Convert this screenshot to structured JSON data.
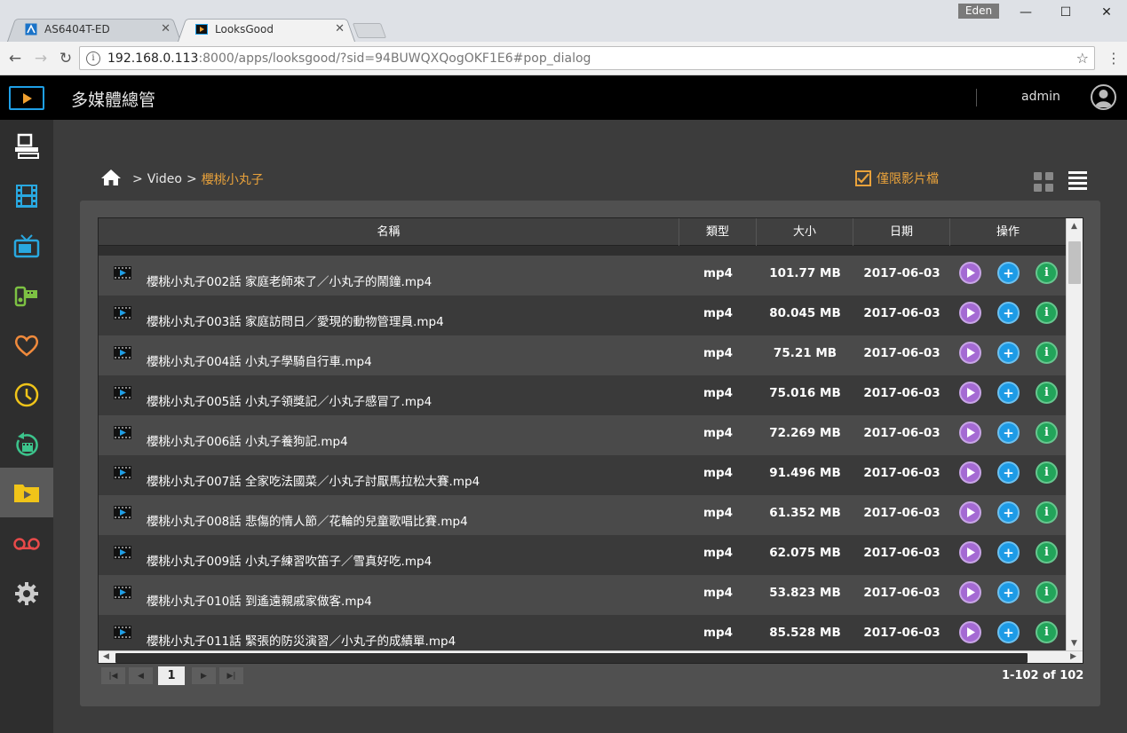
{
  "browser": {
    "tabs": [
      {
        "title": "AS6404T-ED",
        "close": "✕"
      },
      {
        "title": "LooksGood",
        "close": "✕"
      }
    ],
    "profile_name": "Eden",
    "url_host": "192.168.0.113",
    "url_rest": ":8000/apps/looksgood/?sid=94BUWQXQogOKF1E6#pop_dialog",
    "window_controls": {
      "minimize": "—",
      "maximize": "☐",
      "close": "✕"
    }
  },
  "app": {
    "title": "多媒體總管",
    "user": "admin"
  },
  "sidebar": {
    "items": [
      {
        "name": "devices-icon",
        "color": "#ffffff"
      },
      {
        "name": "video-icon",
        "color": "#29a8e0"
      },
      {
        "name": "tv-icon",
        "color": "#29a8e0"
      },
      {
        "name": "camcorder-icon",
        "color": "#7dc243"
      },
      {
        "name": "favorite-icon",
        "color": "#f08a3c"
      },
      {
        "name": "recent-icon",
        "color": "#f0c419"
      },
      {
        "name": "replay-icon",
        "color": "#3cc48c"
      },
      {
        "name": "folder-icon",
        "color": "#f0c419"
      },
      {
        "name": "recording-icon",
        "color": "#e84a4a"
      },
      {
        "name": "settings-icon",
        "color": "#cccccc"
      }
    ],
    "active_index": 7
  },
  "breadcrumb": {
    "sep1": ">",
    "level1": "Video",
    "sep2": ">",
    "current": "櫻桃小丸子"
  },
  "filter": {
    "video_only_label": "僅限影片檔",
    "checked": true
  },
  "table": {
    "columns": [
      "名稱",
      "類型",
      "大小",
      "日期",
      "操作"
    ],
    "rows": [
      {
        "name": "櫻桃小丸子002話 家庭老師來了／小丸子的鬧鐘.mp4",
        "type": "mp4",
        "size": "101.77 MB",
        "date": "2017-06-03"
      },
      {
        "name": "櫻桃小丸子003話 家庭訪問日／愛現的動物管理員.mp4",
        "type": "mp4",
        "size": "80.045 MB",
        "date": "2017-06-03"
      },
      {
        "name": "櫻桃小丸子004話 小丸子學騎自行車.mp4",
        "type": "mp4",
        "size": "75.21 MB",
        "date": "2017-06-03"
      },
      {
        "name": "櫻桃小丸子005話 小丸子領獎記／小丸子感冒了.mp4",
        "type": "mp4",
        "size": "75.016 MB",
        "date": "2017-06-03"
      },
      {
        "name": "櫻桃小丸子006話 小丸子養狗記.mp4",
        "type": "mp4",
        "size": "72.269 MB",
        "date": "2017-06-03"
      },
      {
        "name": "櫻桃小丸子007話 全家吃法國菜／小丸子討厭馬拉松大賽.mp4",
        "type": "mp4",
        "size": "91.496 MB",
        "date": "2017-06-03"
      },
      {
        "name": "櫻桃小丸子008話 悲傷的情人節／花輪的兒童歌唱比賽.mp4",
        "type": "mp4",
        "size": "61.352 MB",
        "date": "2017-06-03"
      },
      {
        "name": "櫻桃小丸子009話 小丸子練習吹笛子／雪真好吃.mp4",
        "type": "mp4",
        "size": "62.075 MB",
        "date": "2017-06-03"
      },
      {
        "name": "櫻桃小丸子010話 到遙遠親戚家做客.mp4",
        "type": "mp4",
        "size": "53.823 MB",
        "date": "2017-06-03"
      },
      {
        "name": "櫻桃小丸子011話 緊張的防災演習／小丸子的成績單.mp4",
        "type": "mp4",
        "size": "85.528 MB",
        "date": "2017-06-03"
      }
    ],
    "action_info_glyph": "i",
    "action_add_glyph": "+"
  },
  "pager": {
    "current_page": "1",
    "range_text": "1-102 of 102"
  },
  "colors": {
    "accent_orange": "#e9a23b",
    "play_purple": "#a46ad3",
    "add_blue": "#1d9be6",
    "info_green": "#22a45a"
  }
}
